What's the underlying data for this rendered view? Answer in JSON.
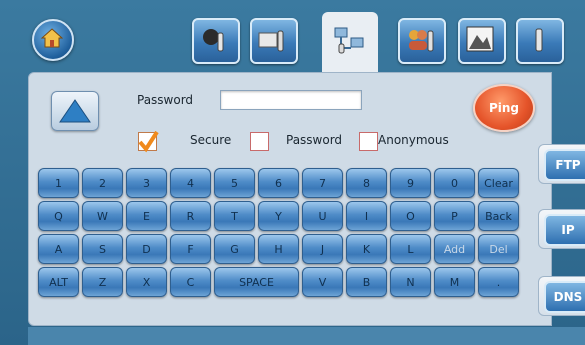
{
  "tabs": [
    {
      "name": "tools-tab"
    },
    {
      "name": "printer-settings-tab"
    },
    {
      "name": "network-tab",
      "active": true
    },
    {
      "name": "users-tab"
    },
    {
      "name": "image-tab"
    },
    {
      "name": "more-tab"
    }
  ],
  "form": {
    "password_label": "Password",
    "password_value": "",
    "secure_label": "Secure",
    "secure_checked": true,
    "password_option_label": "Password",
    "anonymous_label": "Anonymous",
    "ping_label": "Ping"
  },
  "keyboard": {
    "rows": [
      [
        "1",
        "2",
        "3",
        "4",
        "5",
        "6",
        "7",
        "8",
        "9",
        "0",
        "Clear"
      ],
      [
        "Q",
        "W",
        "E",
        "R",
        "T",
        "Y",
        "U",
        "I",
        "O",
        "P",
        "Back"
      ],
      [
        "A",
        "S",
        "D",
        "F",
        "G",
        "H",
        "J",
        "K",
        "L",
        "Add",
        "Del"
      ],
      [
        "ALT",
        "Z",
        "X",
        "C",
        "SPACE",
        "V",
        "B",
        "N",
        "M",
        "."
      ]
    ]
  },
  "side_tabs": [
    "FTP",
    "IP",
    "DNS"
  ],
  "colors": {
    "ping": "#e5542a",
    "key": "#4f8cc8",
    "panel": "#cfdbe6",
    "frame": "#2f6e95"
  }
}
